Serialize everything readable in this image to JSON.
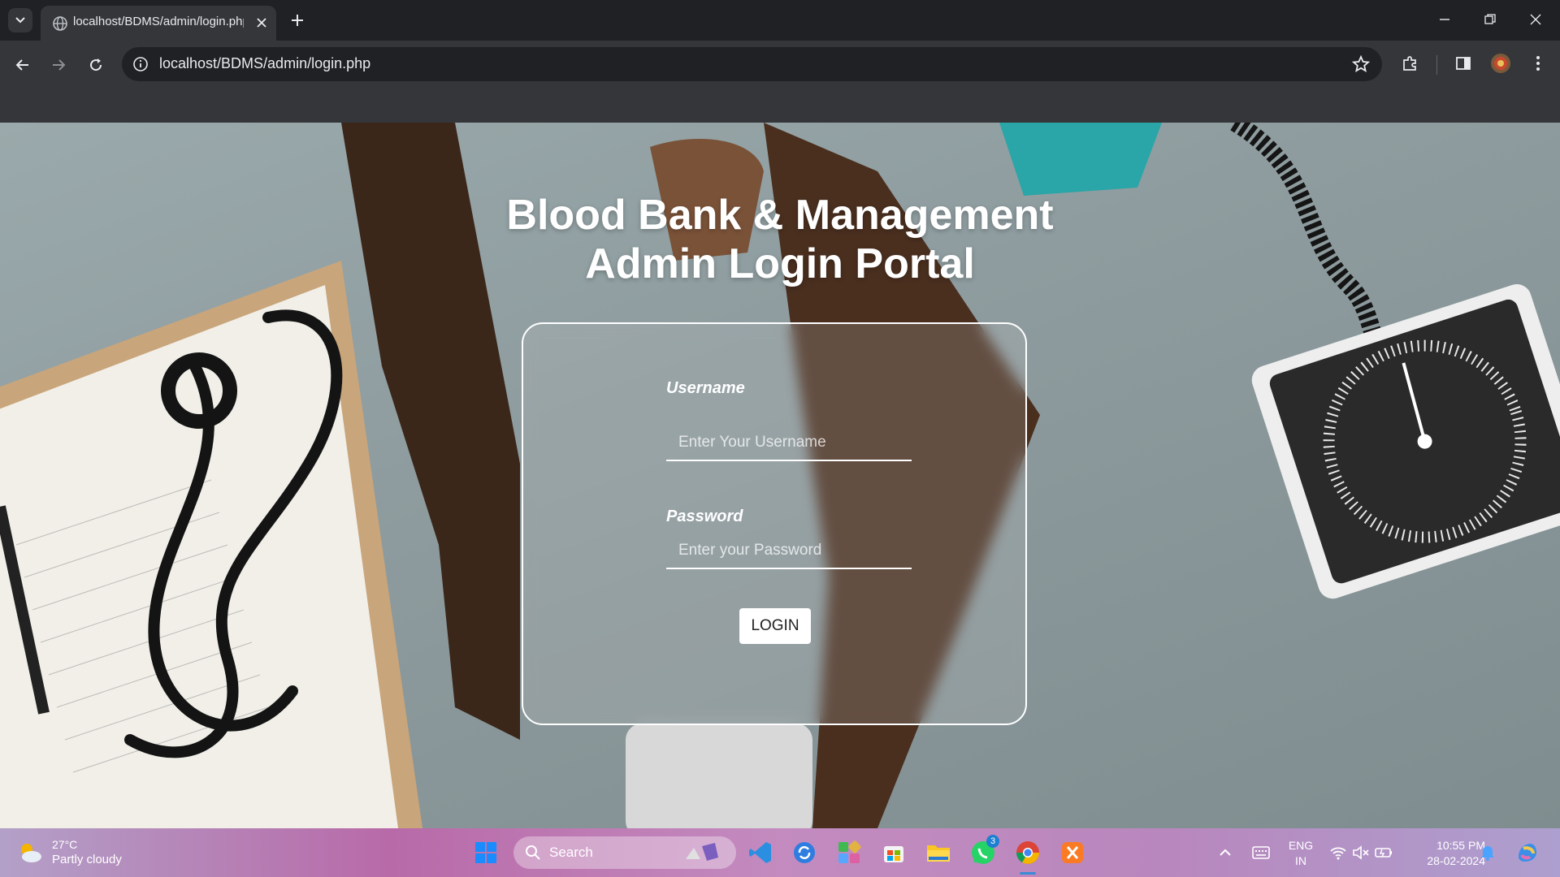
{
  "browser": {
    "tab_title": "localhost/BDMS/admin/login.php",
    "url": "localhost/BDMS/admin/login.php"
  },
  "page": {
    "heading_line1": "Blood Bank & Management",
    "heading_line2": "Admin Login Portal",
    "username_label": "Username",
    "username_placeholder": "Enter Your Username",
    "password_label": "Password",
    "password_placeholder": "Enter your Password",
    "login_label": "LOGIN"
  },
  "taskbar": {
    "weather_temp": "27°C",
    "weather_condition": "Partly cloudy",
    "search_label": "Search",
    "whatsapp_badge": "3",
    "language_line1": "ENG",
    "language_line2": "IN",
    "time": "10:55 PM",
    "date": "28-02-2024"
  },
  "colors": {
    "chrome_dark": "#202124",
    "chrome_toolbar": "#35363a",
    "card_border": "#ffffff"
  }
}
